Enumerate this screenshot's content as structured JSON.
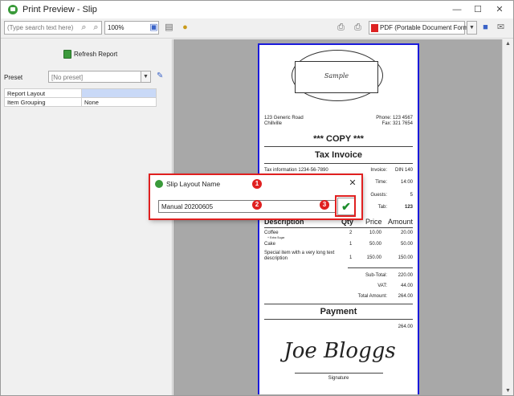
{
  "window": {
    "title": "Print Preview - Slip",
    "minimize": "—",
    "maximize": "☐",
    "close": "✕"
  },
  "toolbar": {
    "search_placeholder": "(Type search text here)",
    "zoom_value": "100%",
    "export_format": "PDF (Portable Document Format)"
  },
  "left_panel": {
    "refresh_label": "Refresh Report",
    "preset_label": "Preset",
    "preset_value": "[No preset]",
    "properties": [
      {
        "name": "Report Layout",
        "value": ""
      },
      {
        "name": "Item Grouping",
        "value": "None"
      }
    ]
  },
  "receipt": {
    "logo_text": "Sample",
    "address_line1": "123 Generic Road",
    "address_line2": "Chillville",
    "phone": "Phone: 123 4567",
    "fax": "Fax: 321 7654",
    "copy_text": "*** COPY ***",
    "doc_title": "Tax Invoice",
    "tax_info": "Tax information 1234-56-7890",
    "invoice_label": "Invoice:",
    "invoice_value": "DIN 140",
    "time_label": "Time:",
    "time_value": "14:00",
    "guests_label": "Guests:",
    "guests_value": "5",
    "tab_label": "Tab:",
    "tab_value": "123",
    "col_description": "Description",
    "col_qty": "Qty",
    "col_price": "Price",
    "col_amount": "Amount",
    "items": [
      {
        "name": "Coffee",
        "note": "+ Extra Sugar",
        "qty": "2",
        "price": "10.00",
        "amount": "20.00"
      },
      {
        "name": "Cake",
        "note": "",
        "qty": "1",
        "price": "50.00",
        "amount": "50.00"
      },
      {
        "name": "Special item with a very long text description",
        "note": "",
        "qty": "1",
        "price": "150.00",
        "amount": "150.00"
      }
    ],
    "subtotal_label": "Sub-Total:",
    "subtotal_value": "220.00",
    "vat_label": "VAT:",
    "vat_value": "44.00",
    "total_label": "Total Amount:",
    "total_value": "264.00",
    "payment_title": "Payment",
    "payment_value": "264.00",
    "signature_text": "Joe Bloggs",
    "signature_label": "Signature"
  },
  "dialog": {
    "title": "Slip Layout Name",
    "close": "✕",
    "input_value": "Manual 20200605",
    "ok_symbol": "✔"
  },
  "callouts": [
    "1",
    "2",
    "3"
  ],
  "colors": {
    "highlight": "#e02020",
    "receipt_border": "#1a1adb",
    "ok_check": "#1d8d2c"
  }
}
